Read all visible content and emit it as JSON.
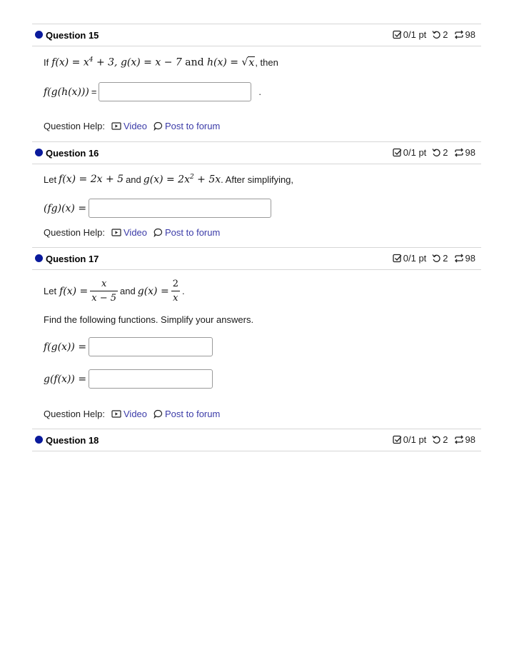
{
  "questions": [
    {
      "title": "Question 15",
      "score": "0/1 pt",
      "retries": "2",
      "attempts": "98",
      "intro_prefix": "If",
      "intro_suffix": ", then",
      "answer_suffix": "."
    },
    {
      "title": "Question 16",
      "score": "0/1 pt",
      "retries": "2",
      "attempts": "98",
      "intro_prefix": "Let",
      "intro_mid": "and",
      "intro_suffix": ". After simplifying,"
    },
    {
      "title": "Question 17",
      "score": "0/1 pt",
      "retries": "2",
      "attempts": "98",
      "intro_prefix": "Let",
      "intro_mid": "and",
      "instructions": "Find the following functions. Simplify your answers."
    },
    {
      "title": "Question 18",
      "score": "0/1 pt",
      "retries": "2",
      "attempts": "98"
    }
  ],
  "help": {
    "label": "Question Help:",
    "video": "Video",
    "forum": "Post to forum"
  },
  "answers": {
    "q15_fgh": "",
    "q16_fg": "",
    "q17_fg": "",
    "q17_gf": ""
  },
  "colors": {
    "status_dot": "#0a1a9c",
    "link": "#3b3ba8"
  }
}
